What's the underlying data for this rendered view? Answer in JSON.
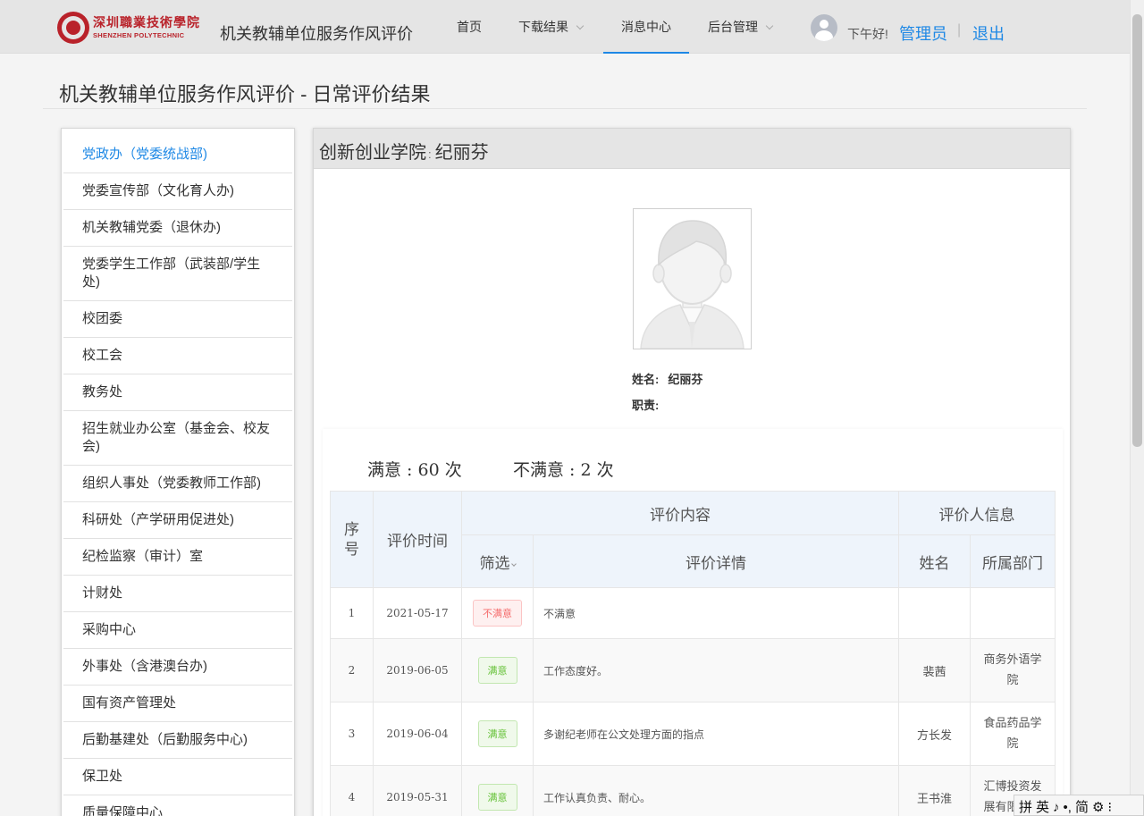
{
  "header": {
    "logo_cn": "深圳職業技術學院",
    "logo_en": "SHENZHEN POLYTECHNIC",
    "site_title": "机关教辅单位服务作风评价",
    "nav": [
      {
        "label": "首页",
        "dropdown": false,
        "active": false
      },
      {
        "label": "下载结果",
        "dropdown": true,
        "active": false
      },
      {
        "label": "消息中心",
        "dropdown": false,
        "active": true
      },
      {
        "label": "后台管理",
        "dropdown": true,
        "active": false
      }
    ],
    "greeting": "下午好!",
    "user": "管理员",
    "separator": "|",
    "logout": "退出",
    "accent_color": "#1e88e5"
  },
  "page_title": "机关教辅单位服务作风评价 - 日常评价结果",
  "sidebar": {
    "items": [
      {
        "label": "党政办（党委统战部)",
        "active": true
      },
      {
        "label": "党委宣传部（文化育人办)",
        "active": false
      },
      {
        "label": "机关教辅党委（退休办)",
        "active": false
      },
      {
        "label": "党委学生工作部（武装部/学生处)",
        "active": false
      },
      {
        "label": "校团委",
        "active": false
      },
      {
        "label": "校工会",
        "active": false
      },
      {
        "label": "教务处",
        "active": false
      },
      {
        "label": "招生就业办公室（基金会、校友会)",
        "active": false
      },
      {
        "label": "组织人事处（党委教师工作部)",
        "active": false
      },
      {
        "label": "科研处（产学研用促进处)",
        "active": false
      },
      {
        "label": "纪检监察（审计）室",
        "active": false
      },
      {
        "label": "计财处",
        "active": false
      },
      {
        "label": "采购中心",
        "active": false
      },
      {
        "label": "外事处（含港澳台办)",
        "active": false
      },
      {
        "label": "国有资产管理处",
        "active": false
      },
      {
        "label": "后勤基建处（后勤服务中心)",
        "active": false
      },
      {
        "label": "保卫处",
        "active": false
      },
      {
        "label": "质量保障中心",
        "active": false
      }
    ]
  },
  "panel": {
    "dept": "创新创业学院",
    "sep": ":",
    "person": "纪丽芬",
    "name_label": "姓名:",
    "name_value": "纪丽芬",
    "duty_label": "职责:",
    "duty_value": "",
    "satisfied": "满意 : 60 次",
    "unsatisfied": "不满意 : 2 次"
  },
  "table": {
    "headers": {
      "index": "序号",
      "time": "评价时间",
      "content": "评价内容",
      "evaluator": "评价人信息",
      "filter": "筛选",
      "detail": "评价详情",
      "name": "姓名",
      "dept": "所属部门"
    },
    "rows": [
      {
        "index": "1",
        "date": "2021-05-17",
        "tag": "不满意",
        "tag_type": "bad",
        "detail": "不满意",
        "name": "",
        "dept": ""
      },
      {
        "index": "2",
        "date": "2019-06-05",
        "tag": "满意",
        "tag_type": "good",
        "detail": "工作态度好。",
        "name": "裴茜",
        "dept": "商务外语学院"
      },
      {
        "index": "3",
        "date": "2019-06-04",
        "tag": "满意",
        "tag_type": "good",
        "detail": "多谢纪老师在公文处理方面的指点",
        "name": "方长发",
        "dept": "食品药品学院"
      },
      {
        "index": "4",
        "date": "2019-05-31",
        "tag": "满意",
        "tag_type": "good",
        "detail": "工作认真负责、耐心。",
        "name": "王书淮",
        "dept": "汇博投资发展有限公司"
      }
    ]
  },
  "ime": [
    "拼",
    "英",
    "♪",
    "•,",
    "简",
    "⚙",
    "⁝"
  ]
}
